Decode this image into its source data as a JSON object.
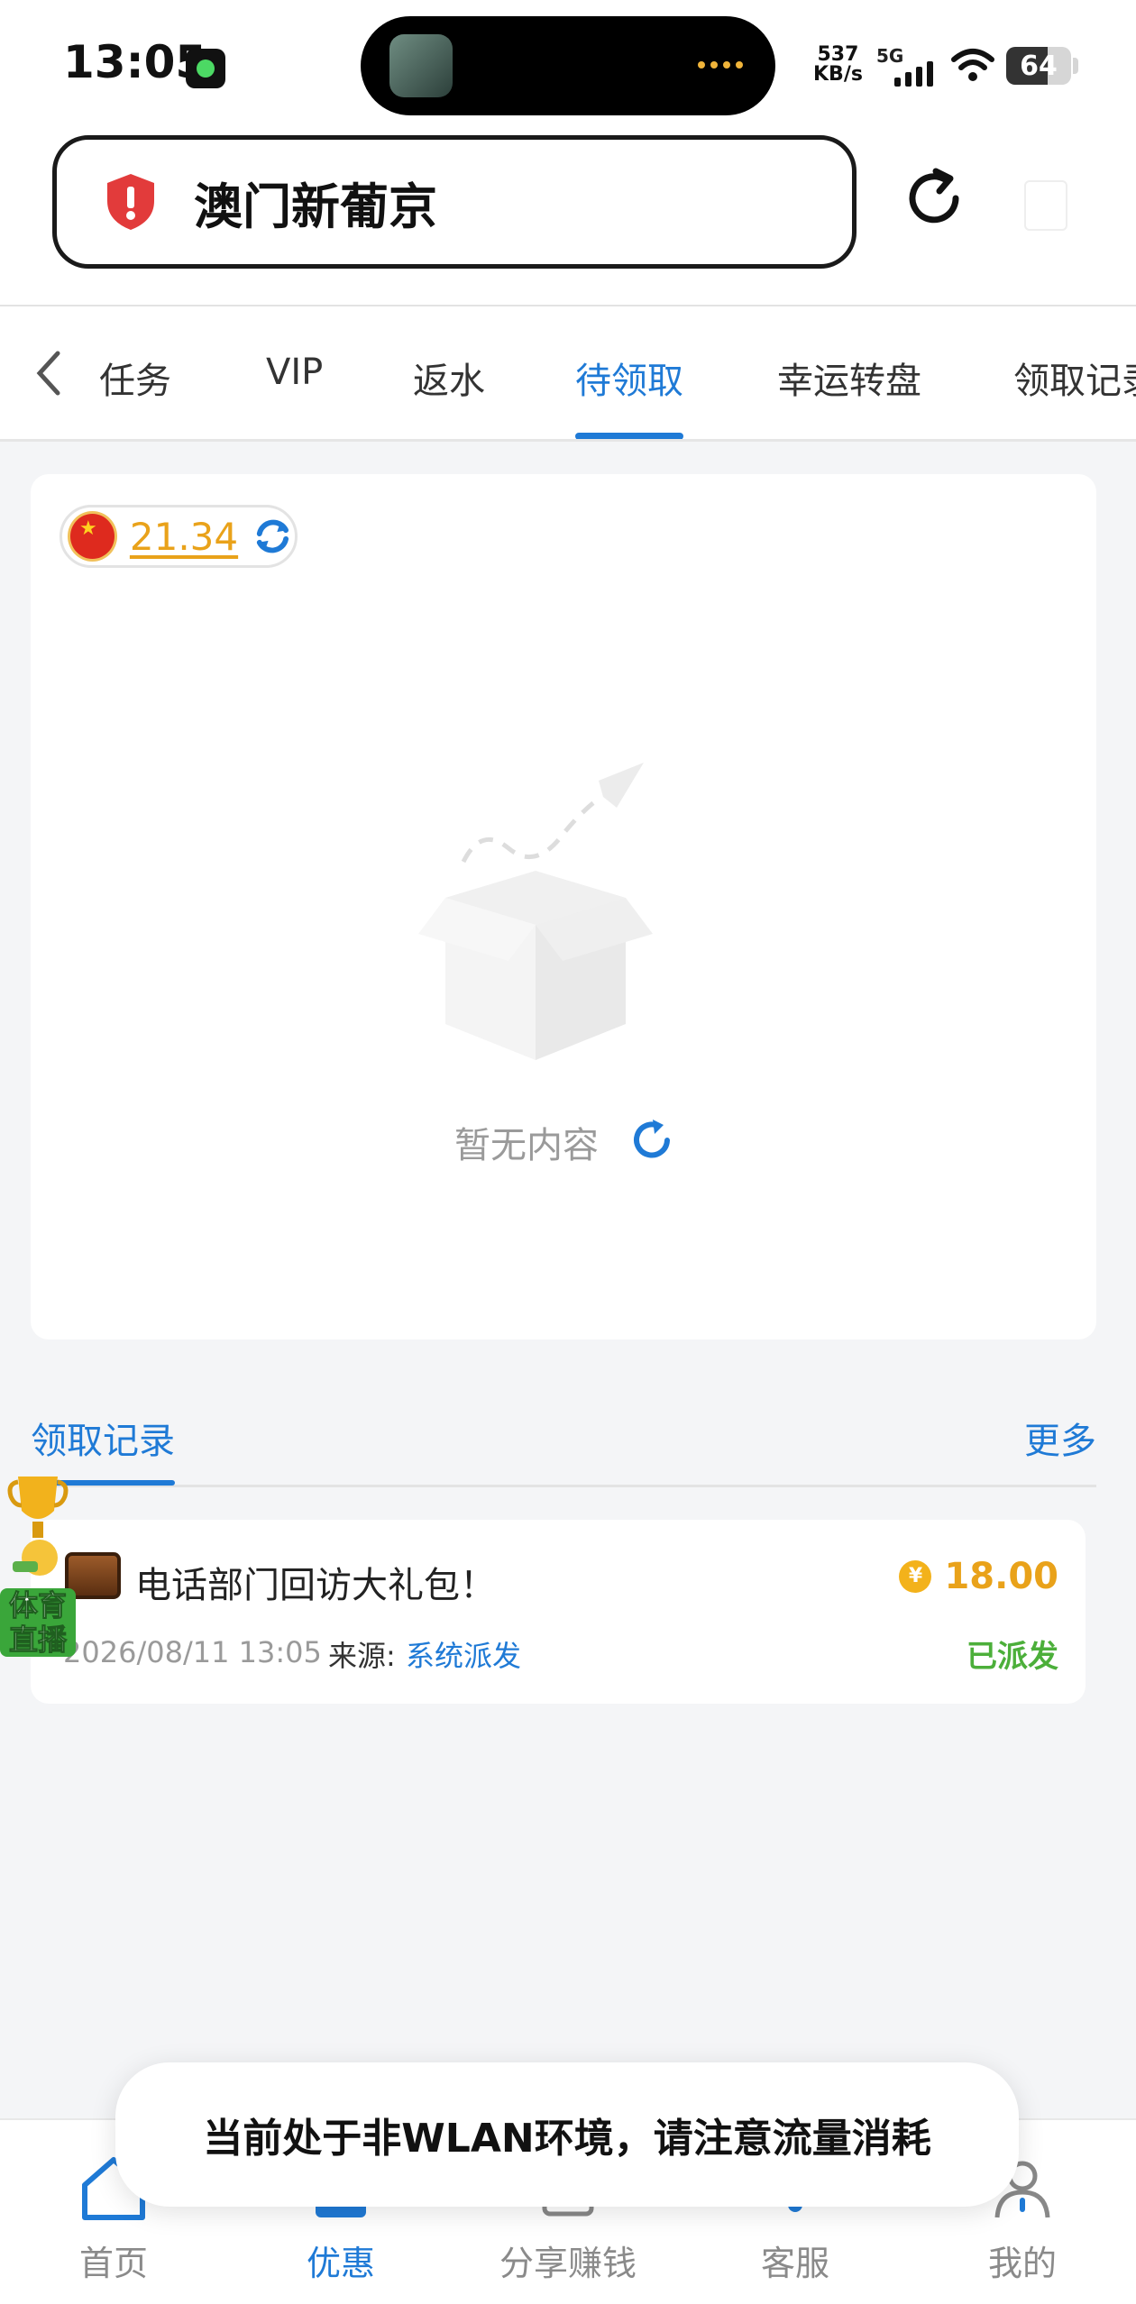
{
  "status_bar": {
    "time": "13:05",
    "net_speed_value": "537",
    "net_speed_unit": "KB/s",
    "network_type": "5G",
    "battery": "64"
  },
  "address_bar": {
    "title": "澳门新葡京"
  },
  "tabs": [
    {
      "label": "任务"
    },
    {
      "label": "VIP"
    },
    {
      "label": "返水"
    },
    {
      "label": "待领取"
    },
    {
      "label": "幸运转盘"
    },
    {
      "label": "领取记录"
    }
  ],
  "active_tab": "待领取",
  "balance": {
    "value": "21.34"
  },
  "empty_state": {
    "text": "暂无内容"
  },
  "records": {
    "title": "领取记录",
    "more_label": "更多",
    "items": [
      {
        "name": "电话部门回访大礼包！",
        "amount": "18.00",
        "time": "2026/08/11 13:05",
        "source_label": "来源:",
        "source": "系统派发",
        "status": "已派发"
      }
    ]
  },
  "floating_badge": {
    "line1": "体育",
    "line2": "直播"
  },
  "bottom_nav": [
    {
      "label": "首页"
    },
    {
      "label": "优惠"
    },
    {
      "label": "分享赚钱"
    },
    {
      "label": "客服"
    },
    {
      "label": "我的"
    }
  ],
  "toast": {
    "text": "当前处于非WLAN环境，请注意流量消耗"
  },
  "colors": {
    "accent": "#1f7ad6",
    "gold": "#e9a21a",
    "success": "#4caf3a"
  }
}
